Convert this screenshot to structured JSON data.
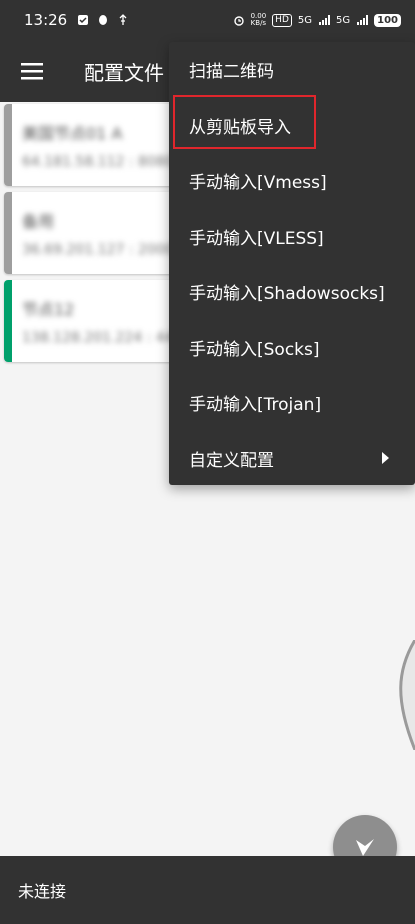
{
  "status_bar": {
    "time": "13:26",
    "net_speed_value": "0.00",
    "net_speed_unit": "KB/s",
    "hd_label": "HD",
    "signal_1": "5G",
    "signal_2": "5G",
    "battery": "100"
  },
  "toolbar": {
    "title": "配置文件",
    "menu_icon": "hamburger-menu-icon"
  },
  "servers": [
    {
      "name": "美国节点01 A",
      "address": "64.181.58.112 : 8080",
      "state": "inactive"
    },
    {
      "name": "备用",
      "address": "36.69.201.127 : 2000",
      "state": "inactive"
    },
    {
      "name": "节点12",
      "address": "138.128.201.224 : 44",
      "state": "active"
    }
  ],
  "popup_menu": {
    "items": [
      {
        "label": "扫描二维码"
      },
      {
        "label": "从剪贴板导入",
        "highlighted": true
      },
      {
        "label": "手动输入[Vmess]"
      },
      {
        "label": "手动输入[VLESS]"
      },
      {
        "label": "手动输入[Shadowsocks]"
      },
      {
        "label": "手动输入[Socks]"
      },
      {
        "label": "手动输入[Trojan]"
      },
      {
        "label": "自定义配置",
        "has_submenu": true
      }
    ],
    "highlight_color": "#e0262c"
  },
  "fab": {
    "icon": "v-logo-icon"
  },
  "bottom_bar": {
    "status": "未连接"
  },
  "colors": {
    "bar": "#323232",
    "active_accent": "#00a06b",
    "inactive_accent": "#9e9e9e"
  }
}
